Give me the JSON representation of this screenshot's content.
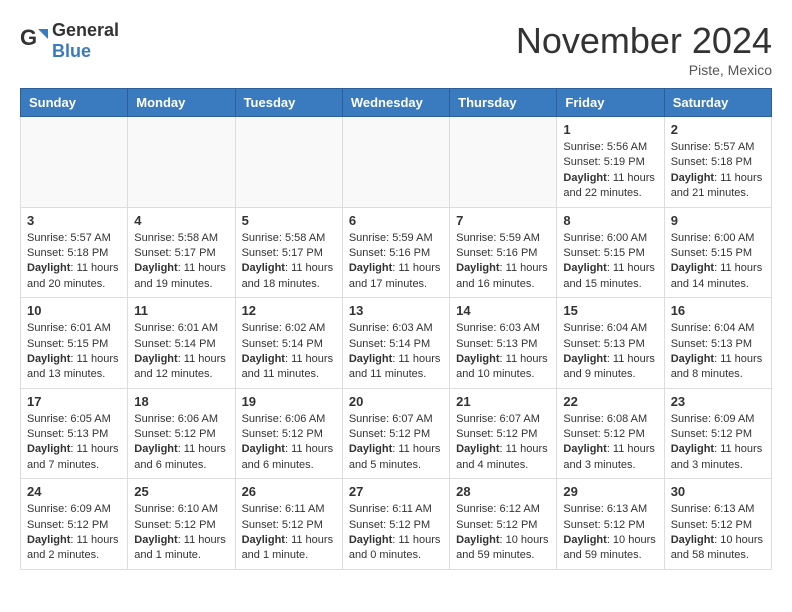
{
  "logo": {
    "general": "General",
    "blue": "Blue"
  },
  "header": {
    "month": "November 2024",
    "location": "Piste, Mexico"
  },
  "weekdays": [
    "Sunday",
    "Monday",
    "Tuesday",
    "Wednesday",
    "Thursday",
    "Friday",
    "Saturday"
  ],
  "weeks": [
    [
      {
        "day": "",
        "info": ""
      },
      {
        "day": "",
        "info": ""
      },
      {
        "day": "",
        "info": ""
      },
      {
        "day": "",
        "info": ""
      },
      {
        "day": "",
        "info": ""
      },
      {
        "day": "1",
        "info": "Sunrise: 5:56 AM\nSunset: 5:19 PM\nDaylight: 11 hours and 22 minutes."
      },
      {
        "day": "2",
        "info": "Sunrise: 5:57 AM\nSunset: 5:18 PM\nDaylight: 11 hours and 21 minutes."
      }
    ],
    [
      {
        "day": "3",
        "info": "Sunrise: 5:57 AM\nSunset: 5:18 PM\nDaylight: 11 hours and 20 minutes."
      },
      {
        "day": "4",
        "info": "Sunrise: 5:58 AM\nSunset: 5:17 PM\nDaylight: 11 hours and 19 minutes."
      },
      {
        "day": "5",
        "info": "Sunrise: 5:58 AM\nSunset: 5:17 PM\nDaylight: 11 hours and 18 minutes."
      },
      {
        "day": "6",
        "info": "Sunrise: 5:59 AM\nSunset: 5:16 PM\nDaylight: 11 hours and 17 minutes."
      },
      {
        "day": "7",
        "info": "Sunrise: 5:59 AM\nSunset: 5:16 PM\nDaylight: 11 hours and 16 minutes."
      },
      {
        "day": "8",
        "info": "Sunrise: 6:00 AM\nSunset: 5:15 PM\nDaylight: 11 hours and 15 minutes."
      },
      {
        "day": "9",
        "info": "Sunrise: 6:00 AM\nSunset: 5:15 PM\nDaylight: 11 hours and 14 minutes."
      }
    ],
    [
      {
        "day": "10",
        "info": "Sunrise: 6:01 AM\nSunset: 5:15 PM\nDaylight: 11 hours and 13 minutes."
      },
      {
        "day": "11",
        "info": "Sunrise: 6:01 AM\nSunset: 5:14 PM\nDaylight: 11 hours and 12 minutes."
      },
      {
        "day": "12",
        "info": "Sunrise: 6:02 AM\nSunset: 5:14 PM\nDaylight: 11 hours and 11 minutes."
      },
      {
        "day": "13",
        "info": "Sunrise: 6:03 AM\nSunset: 5:14 PM\nDaylight: 11 hours and 11 minutes."
      },
      {
        "day": "14",
        "info": "Sunrise: 6:03 AM\nSunset: 5:13 PM\nDaylight: 11 hours and 10 minutes."
      },
      {
        "day": "15",
        "info": "Sunrise: 6:04 AM\nSunset: 5:13 PM\nDaylight: 11 hours and 9 minutes."
      },
      {
        "day": "16",
        "info": "Sunrise: 6:04 AM\nSunset: 5:13 PM\nDaylight: 11 hours and 8 minutes."
      }
    ],
    [
      {
        "day": "17",
        "info": "Sunrise: 6:05 AM\nSunset: 5:13 PM\nDaylight: 11 hours and 7 minutes."
      },
      {
        "day": "18",
        "info": "Sunrise: 6:06 AM\nSunset: 5:12 PM\nDaylight: 11 hours and 6 minutes."
      },
      {
        "day": "19",
        "info": "Sunrise: 6:06 AM\nSunset: 5:12 PM\nDaylight: 11 hours and 6 minutes."
      },
      {
        "day": "20",
        "info": "Sunrise: 6:07 AM\nSunset: 5:12 PM\nDaylight: 11 hours and 5 minutes."
      },
      {
        "day": "21",
        "info": "Sunrise: 6:07 AM\nSunset: 5:12 PM\nDaylight: 11 hours and 4 minutes."
      },
      {
        "day": "22",
        "info": "Sunrise: 6:08 AM\nSunset: 5:12 PM\nDaylight: 11 hours and 3 minutes."
      },
      {
        "day": "23",
        "info": "Sunrise: 6:09 AM\nSunset: 5:12 PM\nDaylight: 11 hours and 3 minutes."
      }
    ],
    [
      {
        "day": "24",
        "info": "Sunrise: 6:09 AM\nSunset: 5:12 PM\nDaylight: 11 hours and 2 minutes."
      },
      {
        "day": "25",
        "info": "Sunrise: 6:10 AM\nSunset: 5:12 PM\nDaylight: 11 hours and 1 minute."
      },
      {
        "day": "26",
        "info": "Sunrise: 6:11 AM\nSunset: 5:12 PM\nDaylight: 11 hours and 1 minute."
      },
      {
        "day": "27",
        "info": "Sunrise: 6:11 AM\nSunset: 5:12 PM\nDaylight: 11 hours and 0 minutes."
      },
      {
        "day": "28",
        "info": "Sunrise: 6:12 AM\nSunset: 5:12 PM\nDaylight: 10 hours and 59 minutes."
      },
      {
        "day": "29",
        "info": "Sunrise: 6:13 AM\nSunset: 5:12 PM\nDaylight: 10 hours and 59 minutes."
      },
      {
        "day": "30",
        "info": "Sunrise: 6:13 AM\nSunset: 5:12 PM\nDaylight: 10 hours and 58 minutes."
      }
    ]
  ]
}
